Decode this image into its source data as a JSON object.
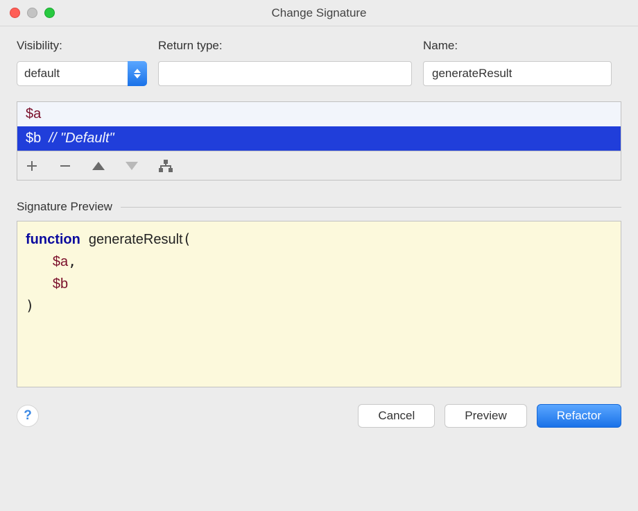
{
  "window": {
    "title": "Change Signature"
  },
  "fields": {
    "visibility": {
      "label": "Visibility:",
      "value": "default"
    },
    "return_type": {
      "label": "Return type:",
      "value": ""
    },
    "name": {
      "label": "Name:",
      "value": "generateResult"
    }
  },
  "parameters": [
    {
      "name": "$a",
      "comment": "",
      "selected": false
    },
    {
      "name": "$b",
      "comment": "// \"Default\"",
      "selected": true
    }
  ],
  "preview": {
    "label": "Signature Preview",
    "keyword": "function",
    "fn_name": "generateResult",
    "params": [
      "$a",
      "$b"
    ]
  },
  "buttons": {
    "cancel": "Cancel",
    "preview": "Preview",
    "refactor": "Refactor",
    "help": "?"
  }
}
